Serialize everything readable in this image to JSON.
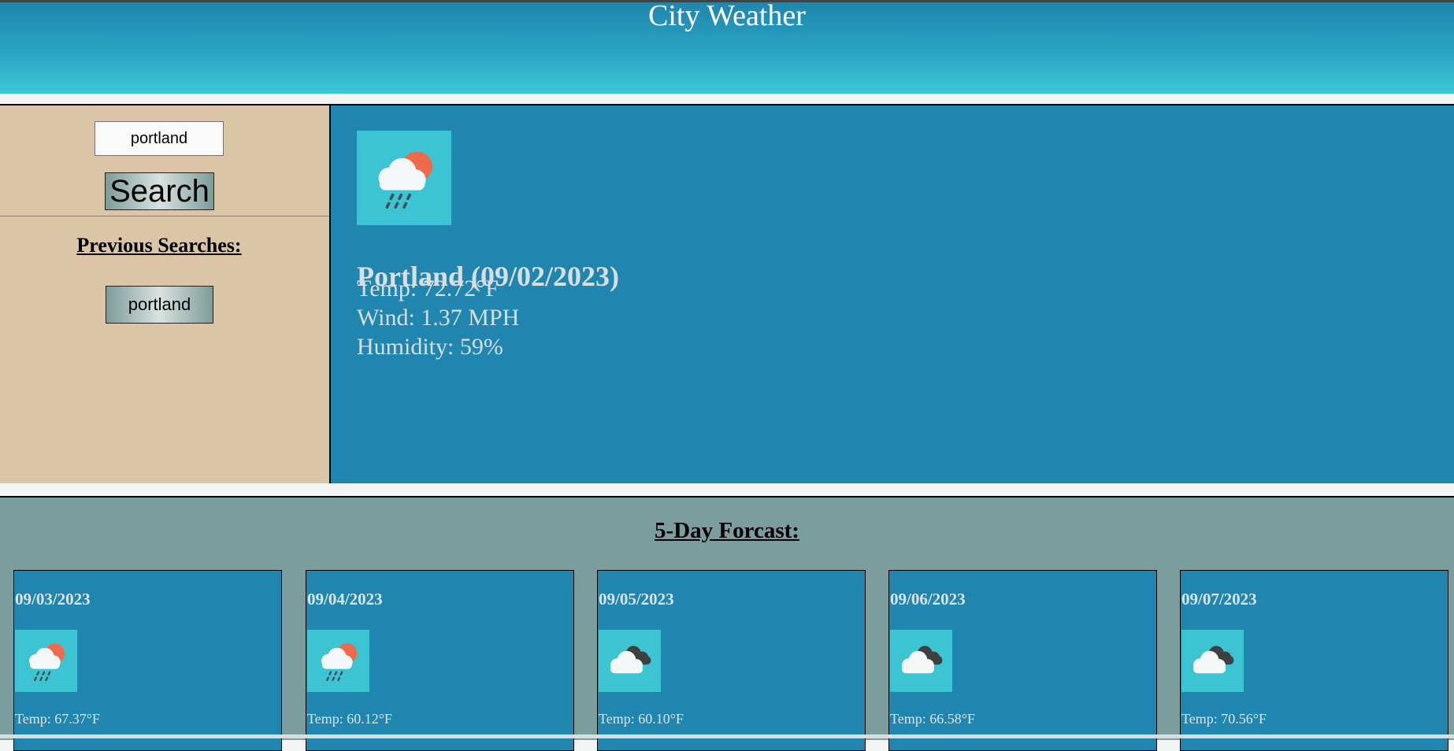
{
  "header": {
    "title": "City Weather"
  },
  "search": {
    "value": "portland",
    "button_label": "Search"
  },
  "previous": {
    "title": "Previous Searches:",
    "items": [
      "portland"
    ]
  },
  "current": {
    "title": "Portland (09/02/2023)",
    "temp": "Temp: 72.72°F",
    "wind": "Wind: 1.37 MPH",
    "humidity": "Humidity: 59%",
    "icon": "rain-sun-icon"
  },
  "forecast": {
    "title": "5-Day Forcast:",
    "days": [
      {
        "date": "09/03/2023",
        "temp": "Temp: 67.37°F",
        "icon": "rain-sun-icon"
      },
      {
        "date": "09/04/2023",
        "temp": "Temp: 60.12°F",
        "icon": "rain-sun-icon"
      },
      {
        "date": "09/05/2023",
        "temp": "Temp: 60.10°F",
        "icon": "cloudy-icon"
      },
      {
        "date": "09/06/2023",
        "temp": "Temp: 66.58°F",
        "icon": "cloudy-icon"
      },
      {
        "date": "09/07/2023",
        "temp": "Temp: 70.56°F",
        "icon": "cloudy-icon"
      }
    ]
  },
  "colors": {
    "header_top": "#1f86ad",
    "header_bottom": "#3cc8d5",
    "sidebar_bg": "#dcc4a6",
    "panel_bg": "#2086b0",
    "forecast_bg": "#7b9d9d",
    "icon_bg": "#3cc4d2",
    "sun": "#ee6a4b",
    "dark_cloud": "#3f3f3f"
  }
}
